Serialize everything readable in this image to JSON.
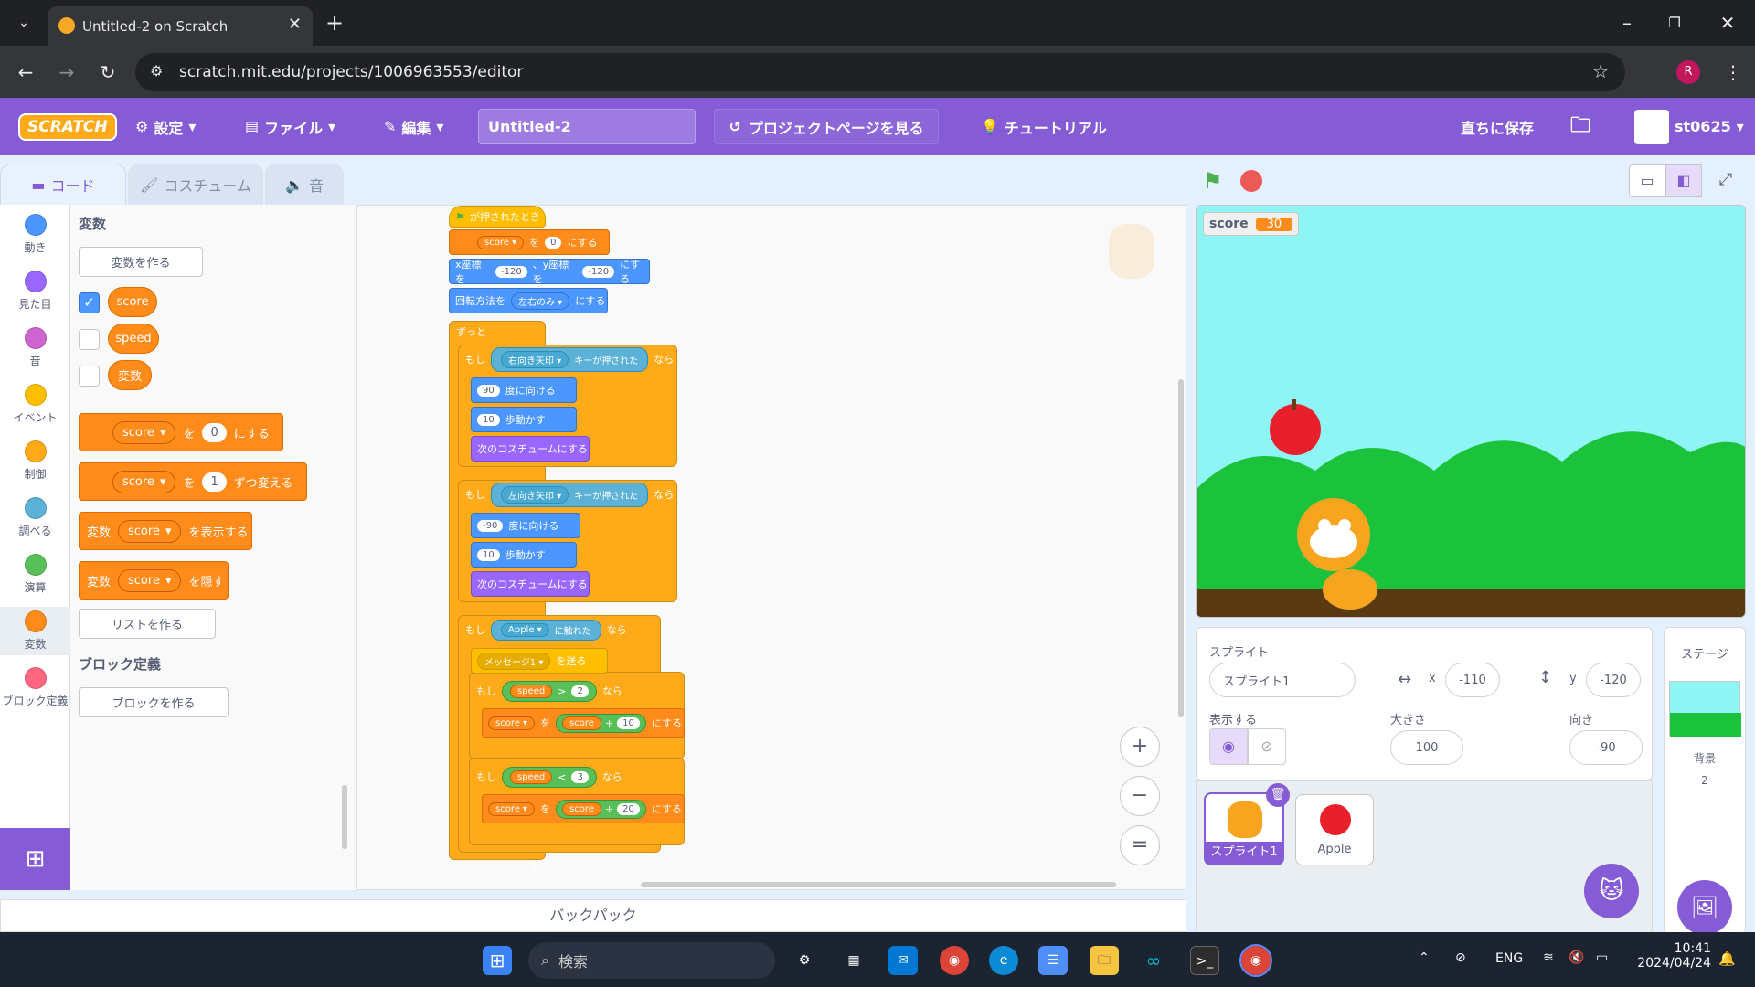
{
  "browser": {
    "tab_title": "Untitled-2 on Scratch",
    "url": "scratch.mit.edu/projects/1006963553/editor",
    "profile_initial": "R"
  },
  "menu": {
    "logo": "SCRATCH",
    "settings": "設定",
    "file": "ファイル",
    "edit": "編集",
    "project_title": "Untitled-2",
    "see_project_page": "プロジェクトページを見る",
    "tutorials": "チュートリアル",
    "save_now": "直ちに保存",
    "username": "st0625"
  },
  "tabs": {
    "code": "コード",
    "costumes": "コスチューム",
    "sounds": "音"
  },
  "categories": [
    {
      "label": "動き",
      "color": "#4c97ff"
    },
    {
      "label": "見た目",
      "color": "#9966ff"
    },
    {
      "label": "音",
      "color": "#cf63cf"
    },
    {
      "label": "イベント",
      "color": "#ffbf00"
    },
    {
      "label": "制御",
      "color": "#ffab19"
    },
    {
      "label": "調べる",
      "color": "#5cb1d6"
    },
    {
      "label": "演算",
      "color": "#59c059"
    },
    {
      "label": "変数",
      "color": "#ff8c1a"
    },
    {
      "label": "ブロック定義",
      "color": "#ff6680"
    }
  ],
  "palette": {
    "heading_variables": "変数",
    "make_variable": "変数を作る",
    "variables": [
      "score",
      "speed",
      "変数"
    ],
    "set_block": {
      "var": "score",
      "word": "を",
      "value": "0",
      "suffix": "にする"
    },
    "change_block": {
      "var": "score",
      "word": "を",
      "value": "1",
      "suffix": "ずつ変える"
    },
    "show_block": {
      "prefix": "変数",
      "var": "score",
      "suffix": "を表示する"
    },
    "hide_block": {
      "prefix": "変数",
      "var": "score",
      "suffix": "を隠す"
    },
    "make_list": "リストを作る",
    "heading_my_blocks": "ブロック定義",
    "make_block": "ブロックを作る"
  },
  "script": {
    "hat": "が押されたとき",
    "set_score": {
      "var": "score",
      "word": "を",
      "value": "0",
      "suffix": "にする"
    },
    "goto": {
      "label_x": "x座標を",
      "x": "-120",
      "label_y": "、y座標を",
      "y": "-120",
      "suffix": "にする"
    },
    "rotation": {
      "prefix": "回転方法を",
      "value": "左右のみ",
      "suffix": "にする"
    },
    "forever": "ずっと",
    "if1": {
      "if": "もし",
      "key": "右向き矢印",
      "pressed": "キーが押された",
      "then": "なら"
    },
    "point1": {
      "value": "90",
      "suffix": "度に向ける"
    },
    "move1": {
      "value": "10",
      "suffix": "歩動かす"
    },
    "costume1": "次のコスチュームにする",
    "if2": {
      "if": "もし",
      "key": "左向き矢印",
      "pressed": "キーが押された",
      "then": "なら"
    },
    "point2": {
      "value": "-90",
      "suffix": "度に向ける"
    },
    "move2": {
      "value": "10",
      "suffix": "歩動かす"
    },
    "costume2": "次のコスチュームにする",
    "if3": {
      "if": "もし",
      "target": "Apple",
      "touching": "に触れた",
      "then": "なら"
    },
    "broadcast": {
      "value": "メッセージ1",
      "suffix": "を送る"
    },
    "if4": {
      "if": "もし",
      "var": "speed",
      "op": ">",
      "value": "2",
      "then": "なら"
    },
    "set4": {
      "var": "score",
      "word": "を",
      "lhs": "score",
      "plus": "+",
      "rhs": "10",
      "suffix": "にする"
    },
    "if5": {
      "if": "もし",
      "var": "speed",
      "op": "<",
      "value": "3",
      "then": "なら"
    },
    "set5": {
      "var": "score",
      "word": "を",
      "lhs": "score",
      "plus": "+",
      "rhs": "20",
      "suffix": "にする"
    }
  },
  "zoom": {
    "in": "+",
    "out": "−",
    "reset": "="
  },
  "stage": {
    "monitor_label": "score",
    "monitor_value": "30"
  },
  "sprite_info": {
    "sprite_label": "スプライト",
    "sprite_name": "スプライト1",
    "x_label": "x",
    "x": "-110",
    "y_label": "y",
    "y": "-120",
    "show_label": "表示する",
    "size_label": "大きさ",
    "size": "100",
    "direction_label": "向き",
    "direction": "-90"
  },
  "sprites": [
    {
      "name": "スプライト1",
      "selected": true
    },
    {
      "name": "Apple",
      "selected": false
    }
  ],
  "stage_panel": {
    "title": "ステージ",
    "backdrops_label": "背景",
    "backdrops_count": "2"
  },
  "backpack": "バックパック",
  "taskbar": {
    "search": "検索",
    "lang": "ENG",
    "time": "10:41",
    "date": "2024/04/24"
  }
}
